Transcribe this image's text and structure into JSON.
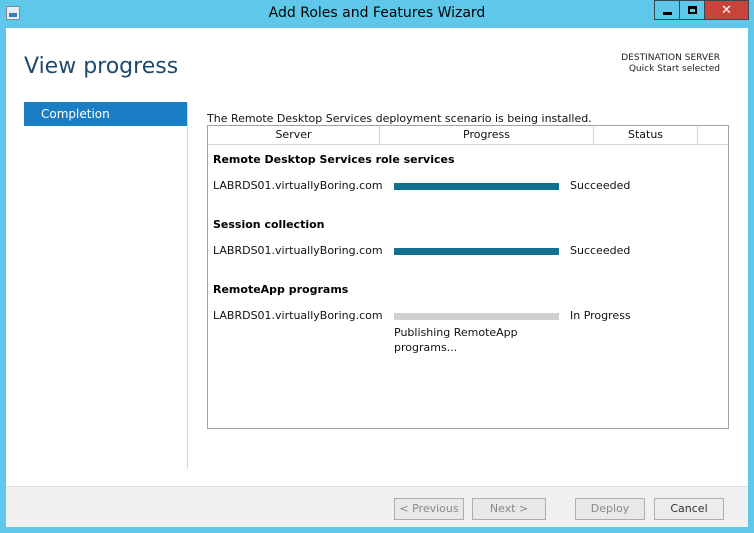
{
  "window": {
    "title": "Add Roles and Features Wizard"
  },
  "header": {
    "page_title": "View progress",
    "destination_label": "DESTINATION SERVER",
    "destination_value": "Quick Start selected"
  },
  "sidebar": {
    "items": [
      {
        "label": "Completion",
        "active": true
      }
    ]
  },
  "main": {
    "intro": "The Remote Desktop Services deployment scenario is being installed.",
    "columns": [
      "Server",
      "Progress",
      "Status",
      ""
    ],
    "groups": [
      {
        "title": "Remote Desktop Services role services",
        "server": "LABRDS01.virtuallyBoring.com",
        "progress": 1.0,
        "status": "Succeeded",
        "detail": ""
      },
      {
        "title": "Session collection",
        "server": "LABRDS01.virtuallyBoring.com",
        "progress": 1.0,
        "status": "Succeeded",
        "detail": ""
      },
      {
        "title": "RemoteApp programs",
        "server": "LABRDS01.virtuallyBoring.com",
        "progress": 0.0,
        "status": "In Progress",
        "detail": "Publishing RemoteApp programs..."
      }
    ]
  },
  "footer": {
    "previous": "< Previous",
    "next": "Next >",
    "deploy": "Deploy",
    "cancel": "Cancel"
  },
  "colors": {
    "title_bar": "#5fc8ea",
    "accent": "#1a7ec5",
    "progress_fill": "#14708f",
    "progress_track": "#d0d0d0",
    "close_button": "#c7443a"
  },
  "icons": [
    "app-icon",
    "minimize-icon",
    "maximize-icon",
    "close-icon"
  ]
}
